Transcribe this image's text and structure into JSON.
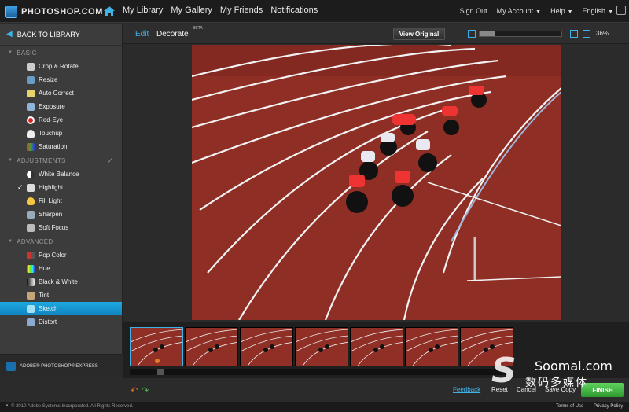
{
  "topbar": {
    "logo_text": "PHOTOSHOP.COM",
    "nav": [
      "My Library",
      "My Gallery",
      "My Friends",
      "Notifications"
    ],
    "sign_out": "Sign Out",
    "my_account": "My Account",
    "help": "Help",
    "language": "English"
  },
  "sidebar": {
    "back": "BACK TO LIBRARY",
    "sections": [
      {
        "title": "BASIC",
        "items": [
          "Crop & Rotate",
          "Resize",
          "Auto Correct",
          "Exposure",
          "Red-Eye",
          "Touchup",
          "Saturation"
        ]
      },
      {
        "title": "ADJUSTMENTS",
        "items": [
          "White Balance",
          "Highlight",
          "Fill Light",
          "Sharpen",
          "Soft Focus"
        ]
      },
      {
        "title": "ADVANCED",
        "items": [
          "Pop Color",
          "Hue",
          "Black & White",
          "Tint",
          "Sketch",
          "Distort"
        ]
      }
    ],
    "brand": "ADOBE® PHOTOSHOP® EXPRESS"
  },
  "editor": {
    "tab_edit": "Edit",
    "tab_decorate": "Decorate",
    "beta": "BETA",
    "view_original": "View Original",
    "zoom_percent": "36%",
    "zoom_level": 0.18
  },
  "actions": {
    "feedback": "Feedback",
    "reset": "Reset",
    "cancel": "Cancel",
    "save_copy": "Save Copy",
    "finish": "FINISH"
  },
  "footer": {
    "copyright": "© 2010 Adobe Systems Incorporated. All Rights Reserved.",
    "terms": "Terms of Use",
    "privacy": "Privacy Policy"
  },
  "watermark": {
    "line1": "Soomal.com",
    "line2": "数码多媒体"
  },
  "colors": {
    "accent": "#1fa8e0",
    "finish": "#3fb33f",
    "track": "#8c2c24"
  }
}
